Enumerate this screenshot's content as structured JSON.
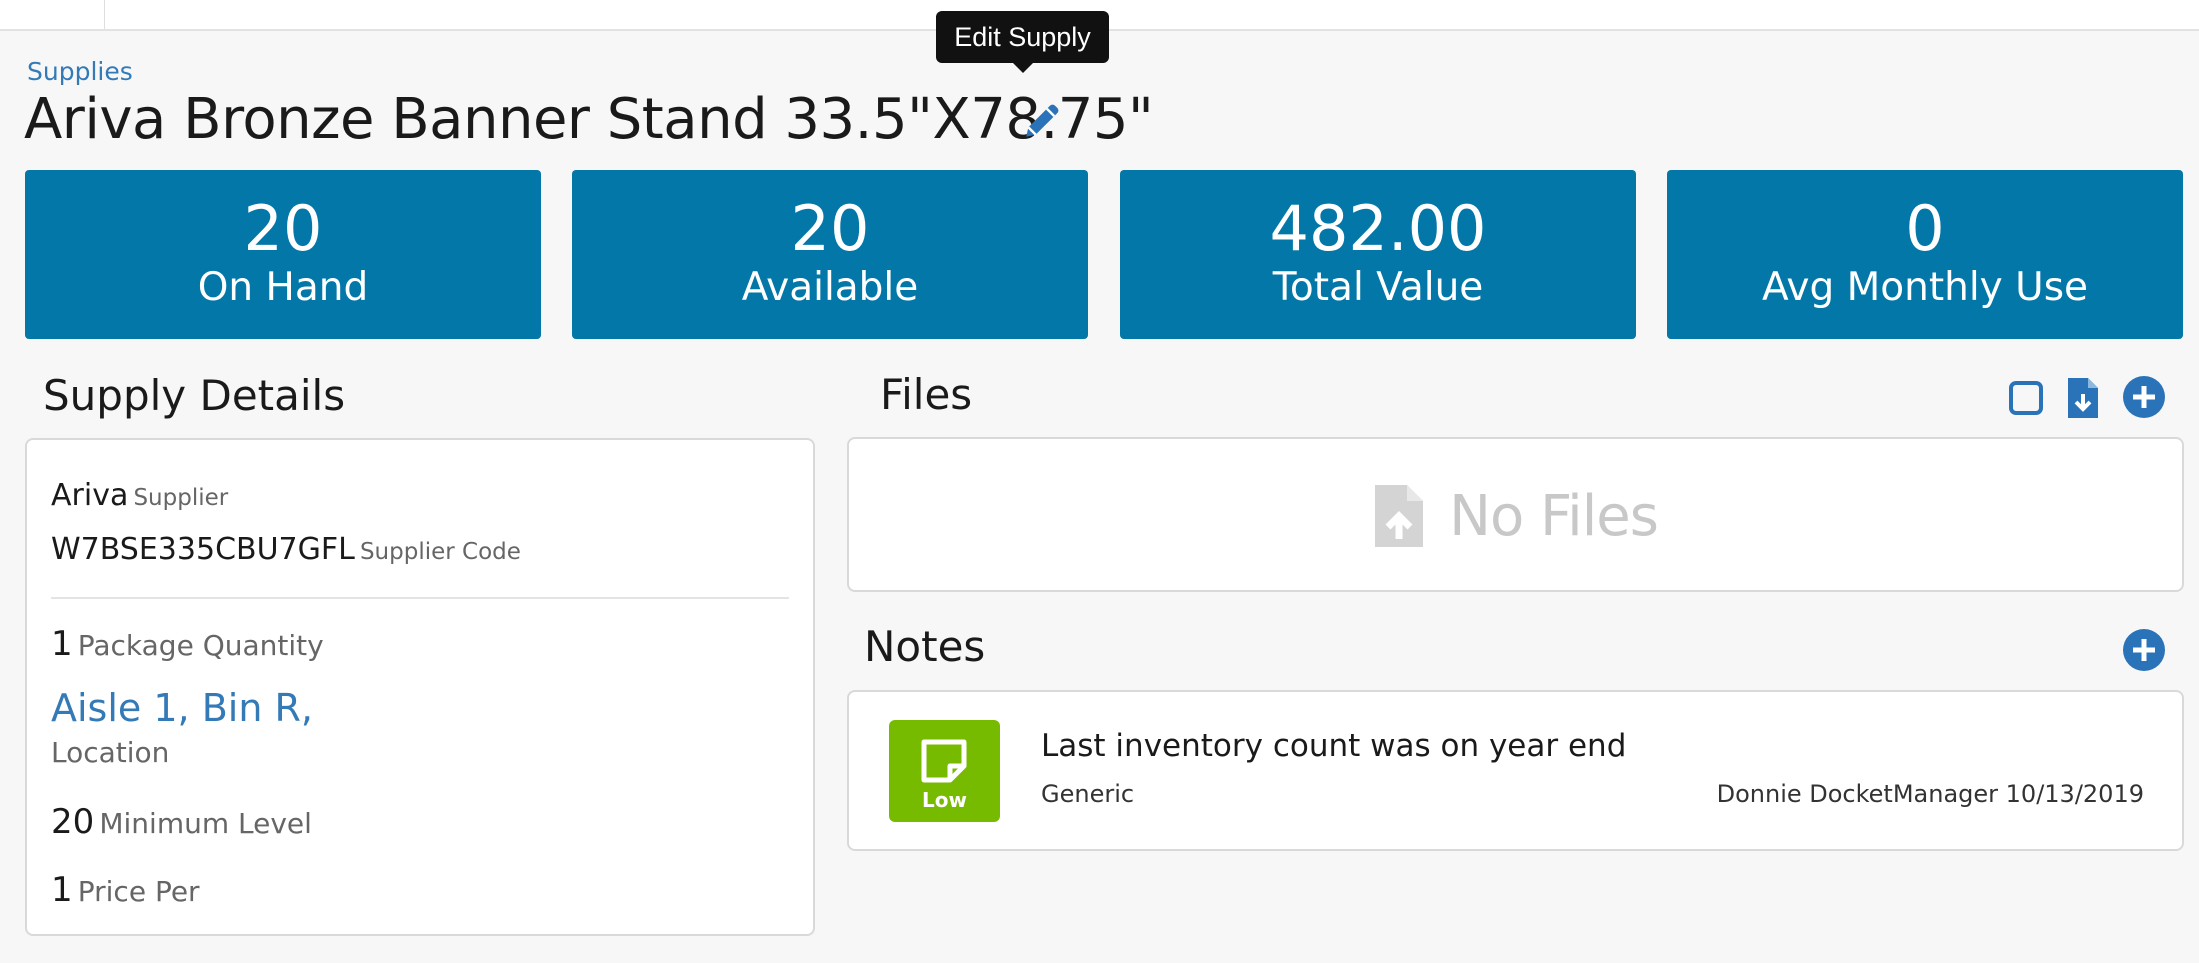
{
  "breadcrumb": {
    "label": "Supplies"
  },
  "page": {
    "title": "Ariva Bronze Banner Stand 33.5\"X78.75\""
  },
  "tooltip": {
    "text": "Edit Supply"
  },
  "stats": [
    {
      "value": "20",
      "label": "On Hand"
    },
    {
      "value": "20",
      "label": "Available"
    },
    {
      "value": "482.00",
      "label": "Total Value"
    },
    {
      "value": "0",
      "label": "Avg Monthly Use"
    }
  ],
  "details": {
    "title": "Supply Details",
    "supplier": {
      "value": "Ariva",
      "label": "Supplier"
    },
    "supplier_code": {
      "value": "W7BSE335CBU7GFL",
      "label": "Supplier Code"
    },
    "package_quantity": {
      "value": "1",
      "label": "Package Quantity"
    },
    "location": {
      "value": "Aisle 1, Bin R,",
      "label": "Location"
    },
    "minimum_level": {
      "value": "20",
      "label": "Minimum Level"
    },
    "price_per": {
      "value": "1",
      "label": "Price Per"
    }
  },
  "files": {
    "title": "Files",
    "empty_text": "No Files"
  },
  "notes": {
    "title": "Notes",
    "items": [
      {
        "badge": "Low",
        "text": "Last inventory count was on year end",
        "type": "Generic",
        "meta": "Donnie DocketManager 10/13/2019"
      }
    ]
  },
  "colors": {
    "stat_bg": "#0277a8",
    "link": "#337ab7",
    "note_badge": "#77bb00",
    "icon_blue": "#2a73b8"
  },
  "icons": {
    "edit": "pencil-icon",
    "select_all": "checkbox-icon",
    "download": "file-download-icon",
    "add_file": "plus-circle-icon",
    "add_note": "plus-circle-icon",
    "no_files": "file-upload-icon",
    "note": "sticky-note-icon"
  }
}
